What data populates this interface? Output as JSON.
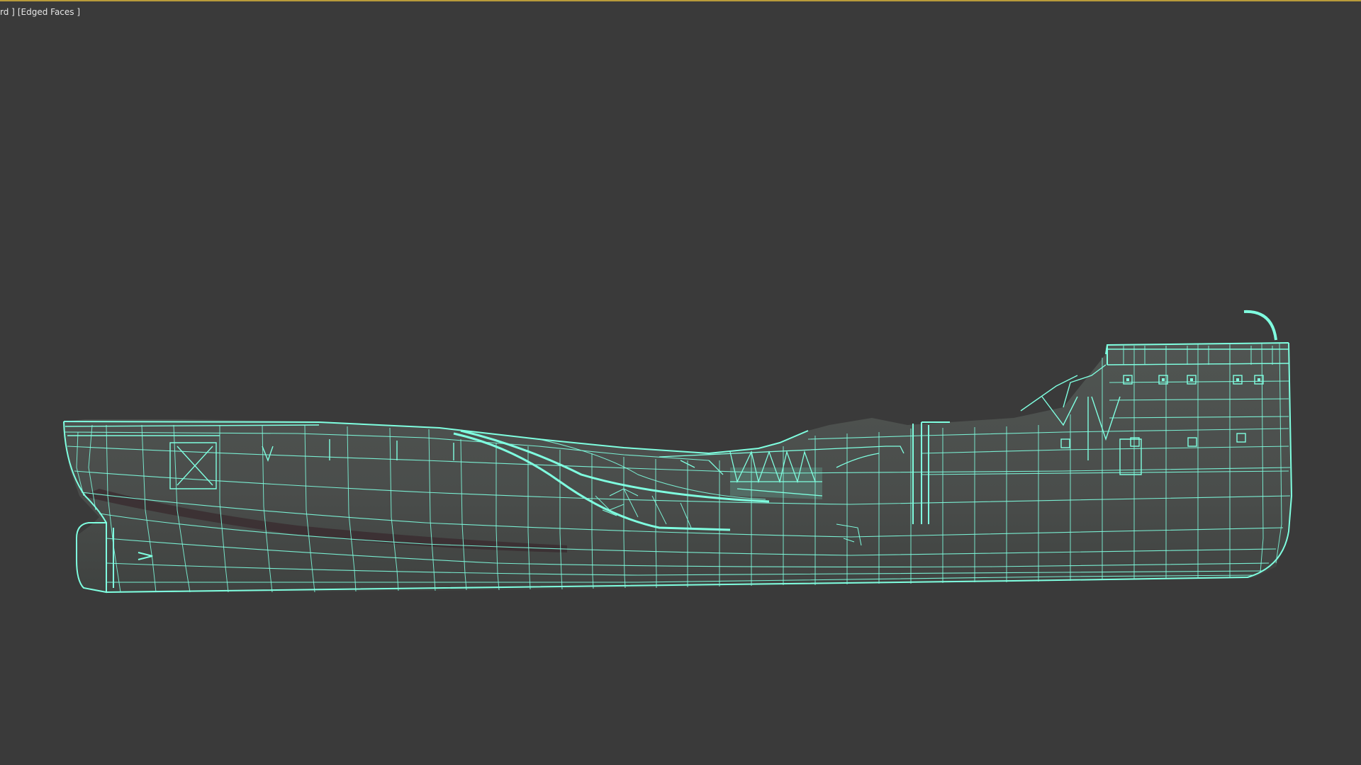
{
  "viewport": {
    "label_shading_partial": "rd ]",
    "label_edged_faces": "[Edged Faces ]"
  },
  "scene": {
    "object": "ship-hull-wireframe",
    "wire_color": "#7fffe0",
    "hull_fill_color": "#4a4f4b",
    "background_color": "#3a3a3a"
  }
}
